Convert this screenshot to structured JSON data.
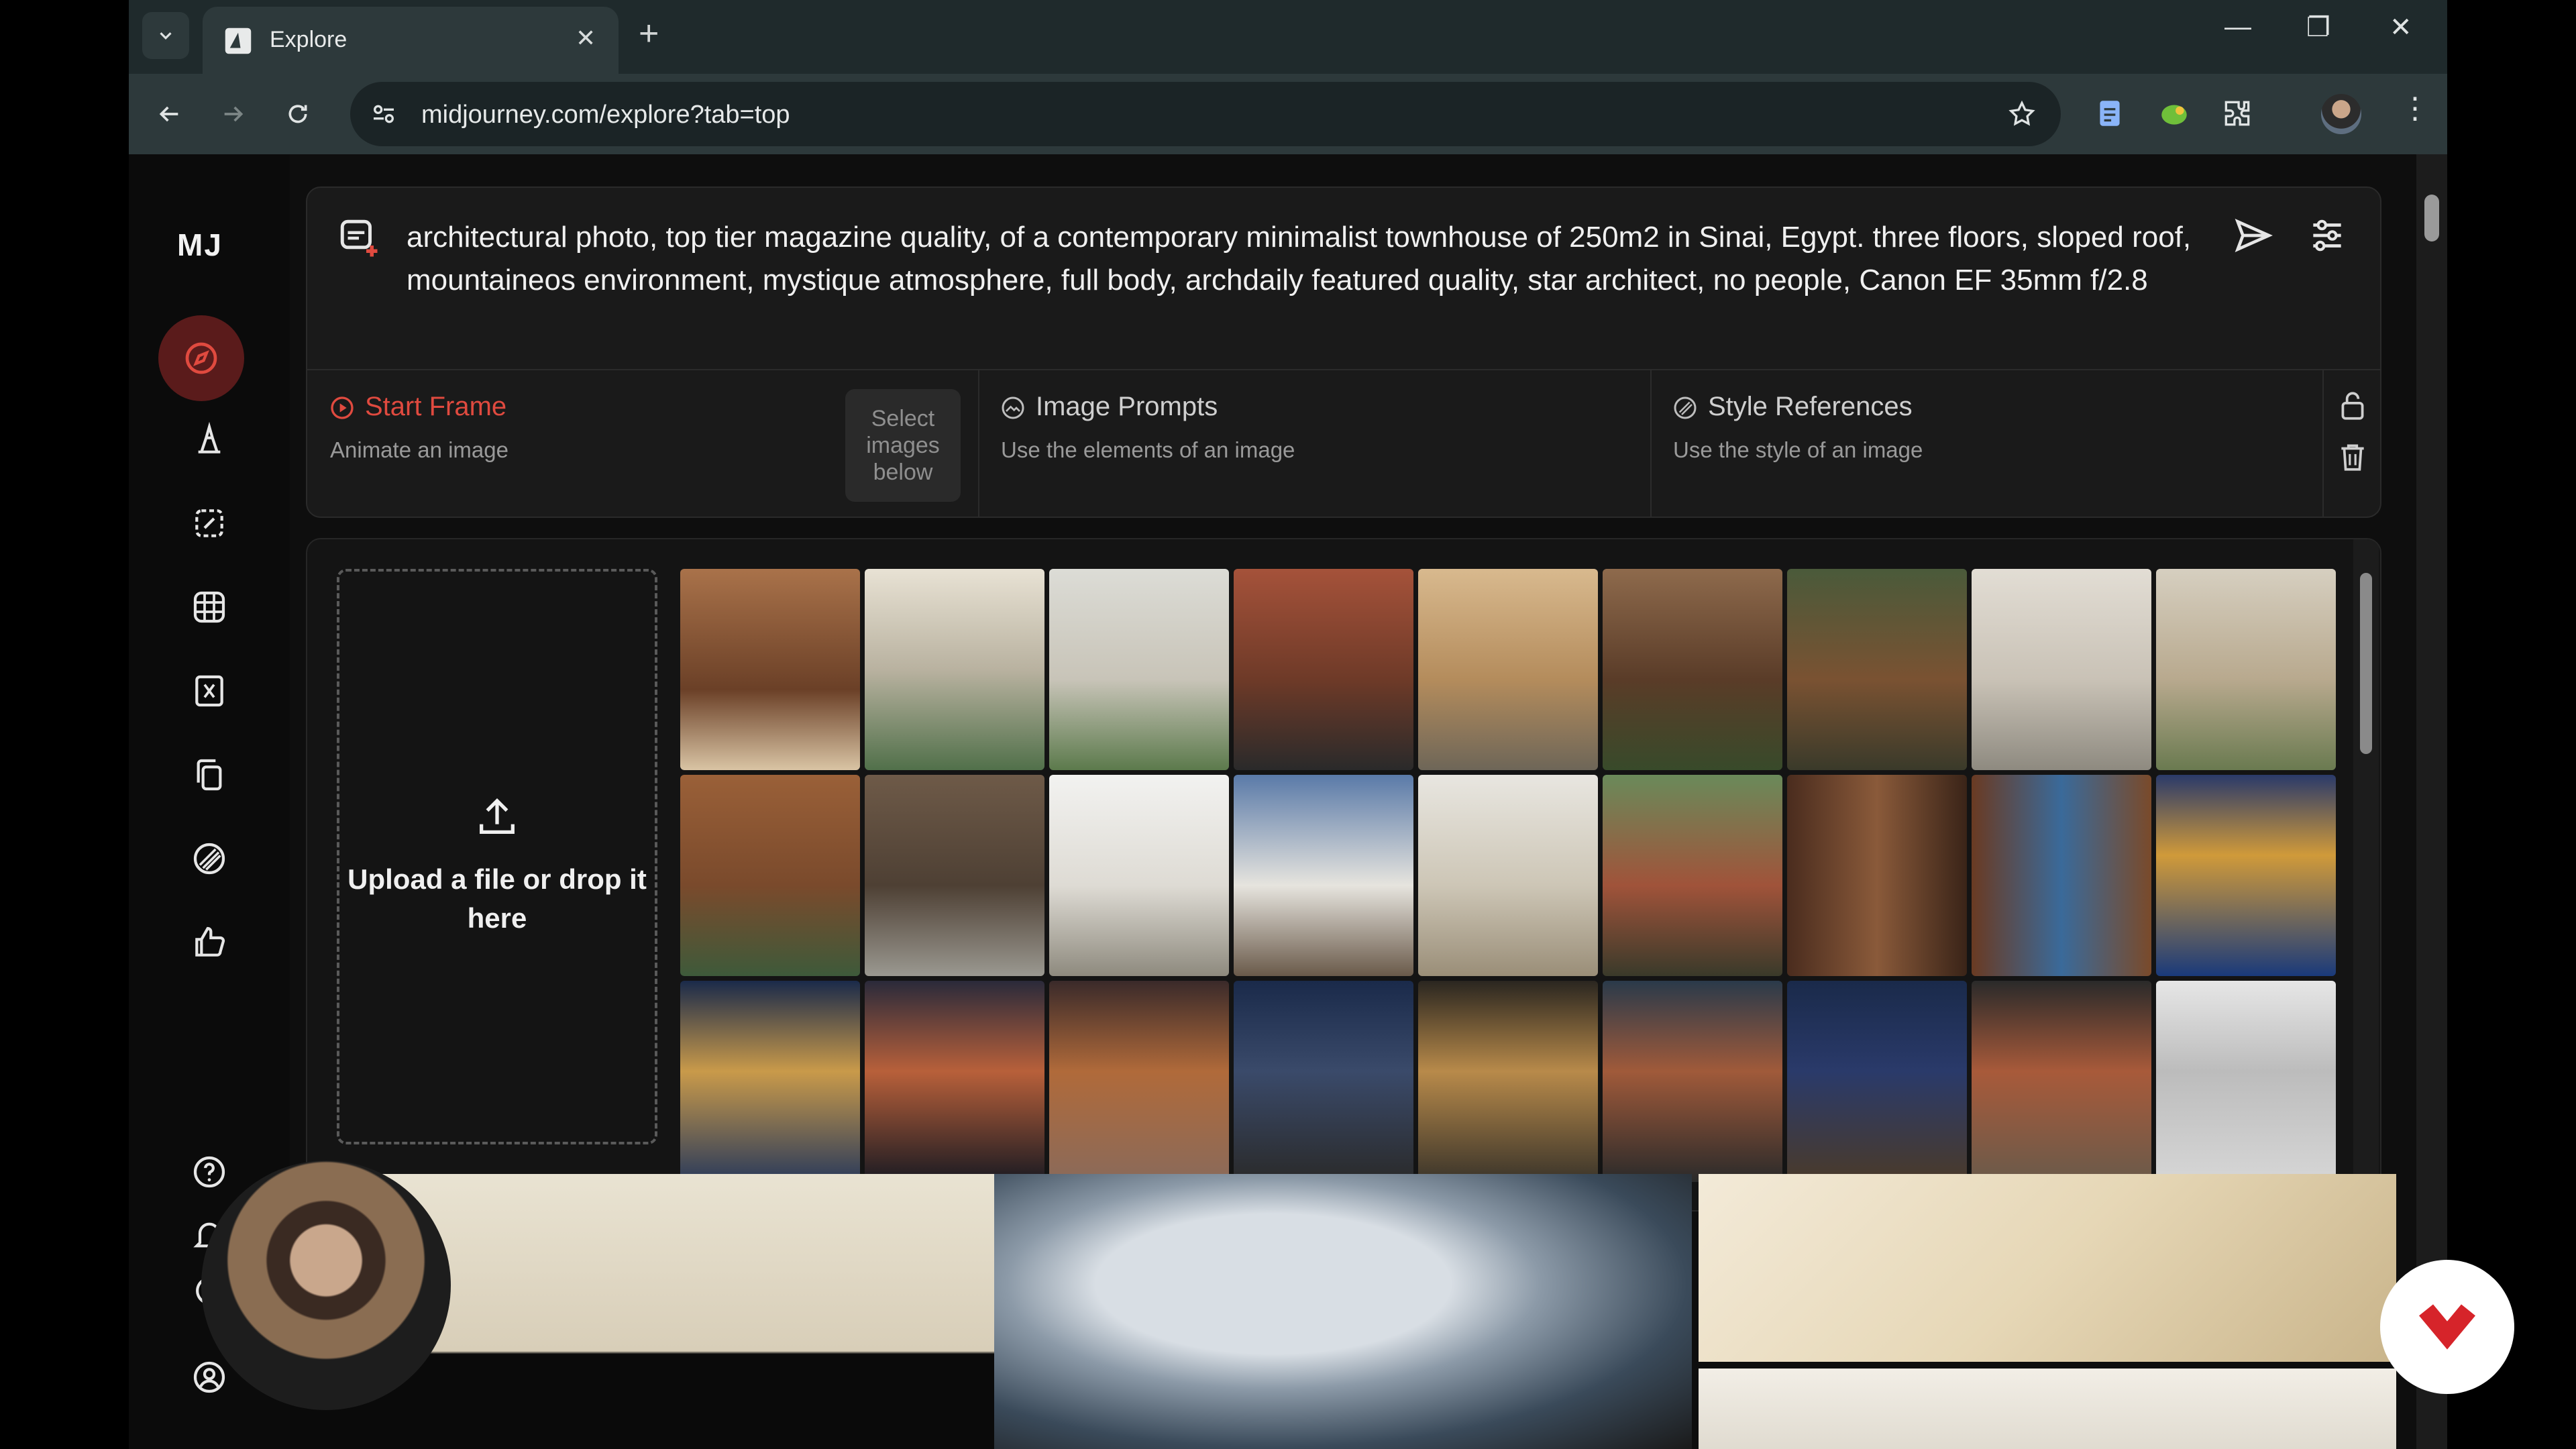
{
  "browser": {
    "tab_title": "Explore",
    "url": "midjourney.com/explore?tab=top"
  },
  "sidebar": {
    "logo": "MJ",
    "items": [
      "explore-icon",
      "create-icon",
      "edit-icon",
      "organize-icon",
      "personalize-icon",
      "copy-icon",
      "style-icon",
      "likes-icon"
    ]
  },
  "prompt": {
    "text": "architectural photo, top tier magazine quality, of a contemporary minimalist townhouse of 250m2 in Sinai, Egypt. three floors, sloped roof, mountaineos environment, mystique atmosphere, full body, archdaily featured quality, star architect, no people, Canon EF 35mm f/2.8"
  },
  "sections": {
    "start_frame": {
      "title": "Start Frame",
      "subtitle": "Animate an image",
      "select_label": "Select images below"
    },
    "image_prompts": {
      "title": "Image Prompts",
      "subtitle": "Use the elements of an image"
    },
    "style_references": {
      "title": "Style References",
      "subtitle": "Use the style of an image"
    }
  },
  "upload": {
    "text": "Upload a file or drop it here"
  },
  "colors": {
    "accent": "#e04a3f",
    "panel": "#1a1a1a",
    "background": "#0e0e0e"
  }
}
